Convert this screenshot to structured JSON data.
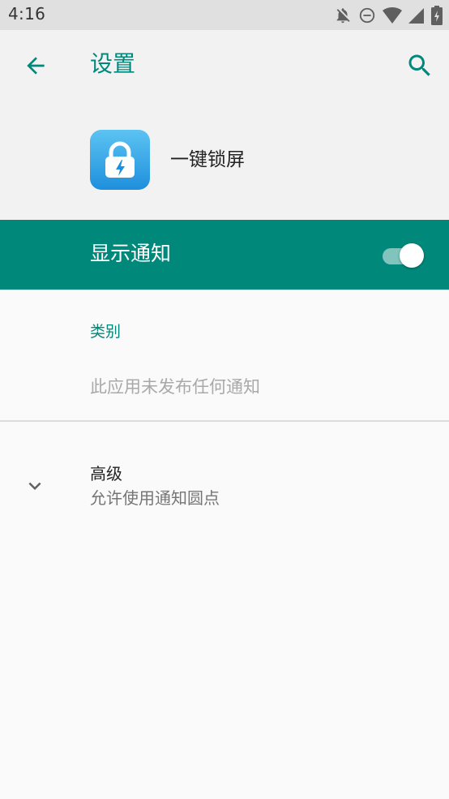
{
  "status_bar": {
    "time": "4:16",
    "icons": [
      "notifications-off-icon",
      "do-not-disturb-icon",
      "wifi-icon",
      "cell-signal-icon",
      "battery-charging-icon"
    ]
  },
  "app_bar": {
    "title": "设置",
    "back_icon": "arrow-back-icon",
    "search_icon": "search-icon",
    "accent_color": "#00897b"
  },
  "app_header": {
    "app_name": "一键锁屏",
    "icon": "lock-icon"
  },
  "show_notifications": {
    "label": "显示通知",
    "enabled": true
  },
  "categories": {
    "header": "类别",
    "empty_text": "此应用未发布任何通知"
  },
  "advanced": {
    "title": "高级",
    "summary": "允许使用通知圆点",
    "icon": "chevron-down-icon"
  }
}
